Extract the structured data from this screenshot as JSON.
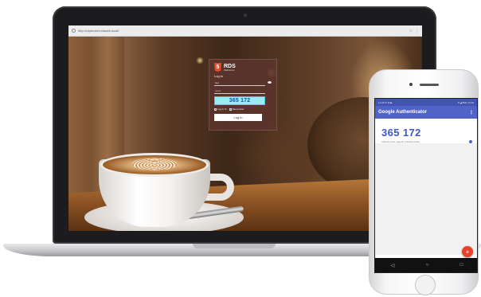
{
  "browser": {
    "url": "http://rdpbroker.rdsweb.local/"
  },
  "login": {
    "app_name": "RDS",
    "app_subtitle": "Webfence",
    "logo_glyph": "5",
    "heading": "Log in",
    "username_value": "sup",
    "password_value": "•••••••",
    "otp_code": "365 172",
    "option_1": "Log in %",
    "option_2": "Remember",
    "button_label": "Log in"
  },
  "phone": {
    "status_left": "14:26 ✉ ⚙ ▶",
    "status_right": "▼◢ 86% 14:26",
    "app_title": "Google Authenticator",
    "menu_glyph": "⋮",
    "code": "365 172",
    "account": "rdsweb.local: support (rdsweb.local)",
    "fab_glyph": "+",
    "nav_back": "◁",
    "nav_home": "○",
    "nav_recent": "□"
  },
  "colors": {
    "accent": "#5063c6",
    "otp_highlight": "#9fe9f5",
    "fab": "#e8412c"
  },
  "icons": [
    "lock-icon",
    "eye-icon",
    "kebab-menu-icon",
    "add-icon",
    "back-icon",
    "home-icon",
    "recents-icon",
    "html5-shield-icon"
  ]
}
